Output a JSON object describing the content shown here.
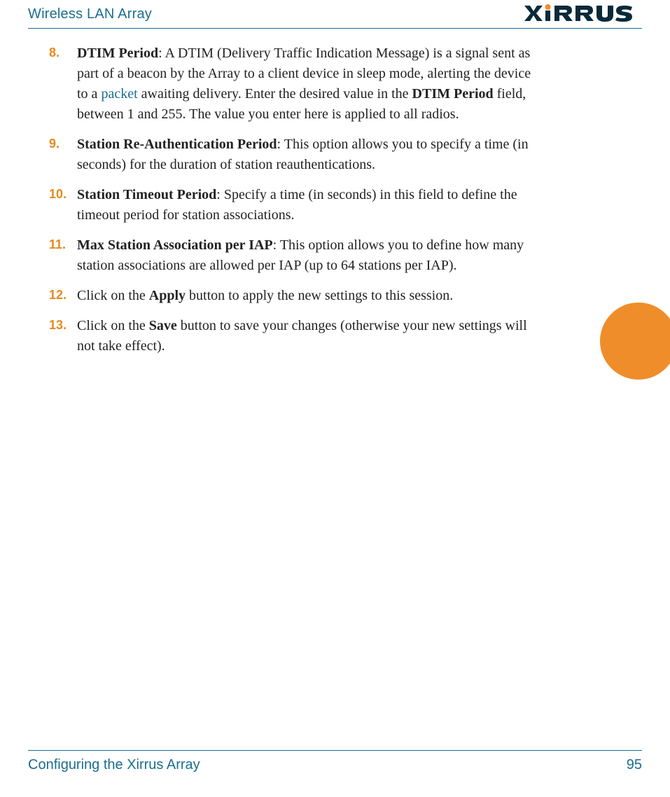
{
  "header": {
    "title": "Wireless LAN Array",
    "logo_text": "XIRRUS"
  },
  "steps": [
    {
      "num": "8.",
      "term": "DTIM Period",
      "body_before_link": ": A DTIM (Delivery Traffic Indication Message) is a signal sent as part of a beacon by the Array to a client device in sleep mode, alerting the device to a ",
      "link": "packet",
      "body_after_link_1": " awaiting delivery. Enter the desired value in the ",
      "inline_term": "DTIM Period",
      "body_after_link_2": " field, between 1 and 255. The value you enter here is applied to all radios."
    },
    {
      "num": "9.",
      "term": "Station Re-Authentication Period",
      "body": ": This option allows you to specify a time (in seconds) for the duration of station reauthentications."
    },
    {
      "num": "10.",
      "term": "Station Timeout Period",
      "body": ": Specify a time (in seconds) in this field to define the timeout period for station associations."
    },
    {
      "num": "11.",
      "term": "Max Station Association per IAP",
      "body": ": This option allows you to define how many station associations are allowed per IAP (up to 64 stations per IAP)."
    },
    {
      "num": "12.",
      "body_before": "Click on the ",
      "ui": "Apply",
      "body_after": " button to apply the new settings to this session."
    },
    {
      "num": "13.",
      "body_before": "Click on the ",
      "ui": "Save",
      "body_after": " button to save your changes (otherwise your new settings will not take effect)."
    }
  ],
  "footer": {
    "section": "Configuring the Xirrus Array",
    "page": "95"
  }
}
